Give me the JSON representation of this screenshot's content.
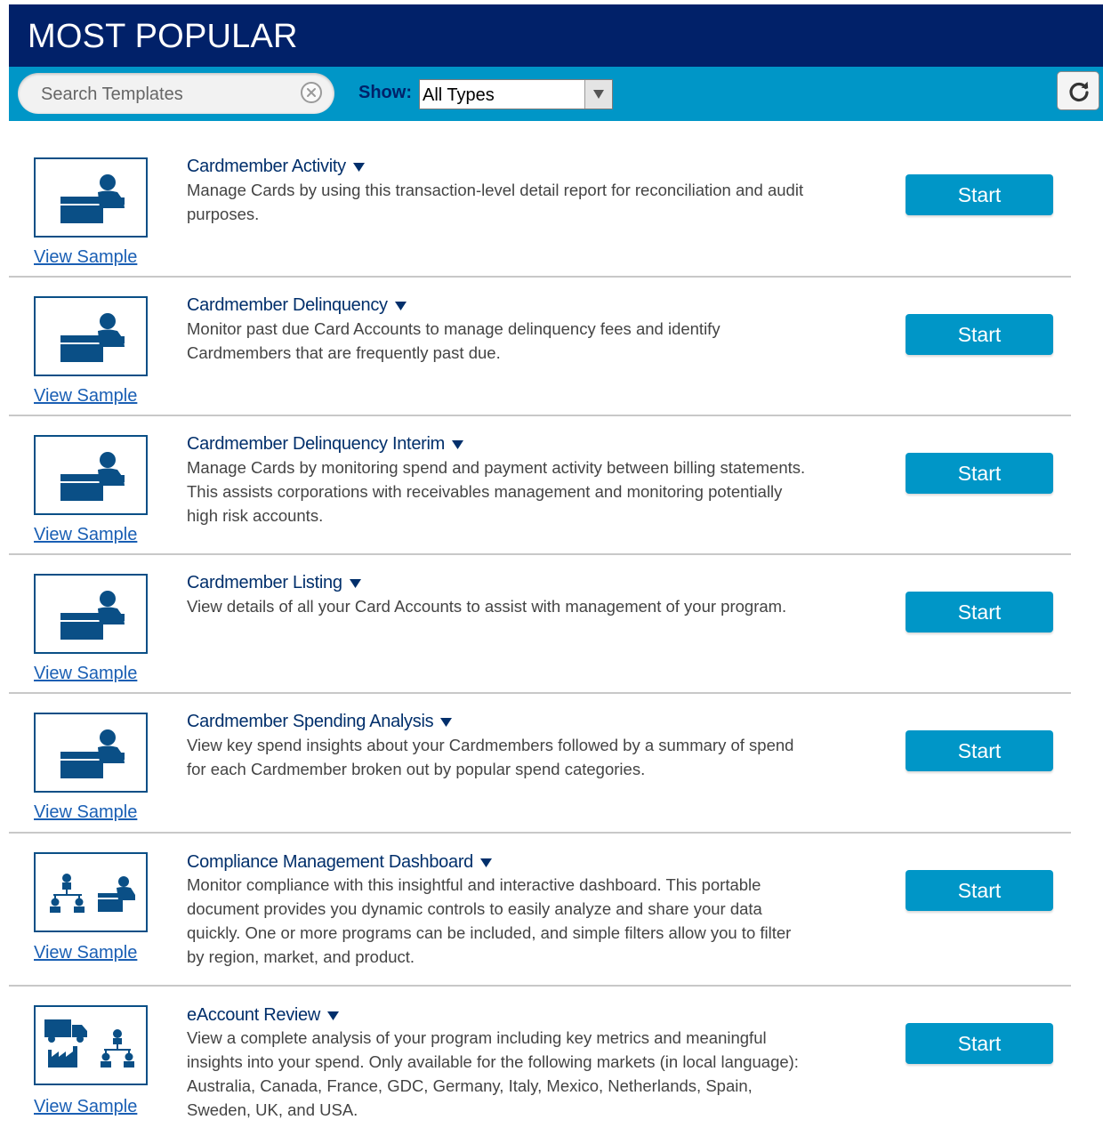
{
  "header": {
    "title": "MOST POPULAR"
  },
  "toolbar": {
    "search_placeholder": "Search Templates",
    "search_value": "",
    "show_label": "Show:",
    "type_selected": "All Types"
  },
  "templates": [
    {
      "title": "Cardmember Activity",
      "description": "Manage Cards by using this transaction-level detail report for reconciliation and audit purposes.",
      "icon": "cardmember-card-icon",
      "view_sample": "View Sample",
      "start": "Start"
    },
    {
      "title": "Cardmember Delinquency",
      "description": "Monitor past due Card Accounts to manage delinquency fees and identify Cardmembers that are frequently past due.",
      "icon": "cardmember-card-icon",
      "view_sample": "View Sample",
      "start": "Start"
    },
    {
      "title": "Cardmember Delinquency Interim",
      "description": "Manage Cards by monitoring spend and payment activity between billing statements. This assists corporations with receivables management and monitoring potentially high risk accounts.",
      "icon": "cardmember-card-icon",
      "view_sample": "View Sample",
      "start": "Start"
    },
    {
      "title": "Cardmember Listing",
      "description": "View details of all your Card Accounts to assist with management of your program.",
      "icon": "cardmember-card-icon",
      "view_sample": "View Sample",
      "start": "Start"
    },
    {
      "title": "Cardmember Spending Analysis",
      "description": "View key spend insights about your Cardmembers followed by a summary of spend for each Cardmember broken out by popular spend categories.",
      "icon": "cardmember-card-icon",
      "view_sample": "View Sample",
      "start": "Start"
    },
    {
      "title": "Compliance Management Dashboard",
      "description": "Monitor compliance with this insightful and interactive dashboard. This portable document provides you dynamic controls to easily analyze and share your data quickly. One or more programs can be included, and simple filters allow you to filter by region, market, and product.",
      "icon": "org-chart-cardmember-icon",
      "view_sample": "View Sample",
      "start": "Start"
    },
    {
      "title": "eAccount Review",
      "description": "View a complete analysis of your program including key metrics and meaningful insights into your spend. Only available for the following markets (in local language): Australia, Canada, France, GDC, Germany, Italy, Mexico, Netherlands, Spain, Sweden, UK, and USA.",
      "icon": "truck-factory-org-icon",
      "view_sample": "View Sample",
      "start": "Start"
    }
  ],
  "colors": {
    "header_bg": "#012169",
    "toolbar_bg": "#0096c7",
    "button_bg": "#0096c7",
    "icon_color": "#0a4f86",
    "title_color": "#012f6b",
    "link_color": "#1a5fb4"
  }
}
